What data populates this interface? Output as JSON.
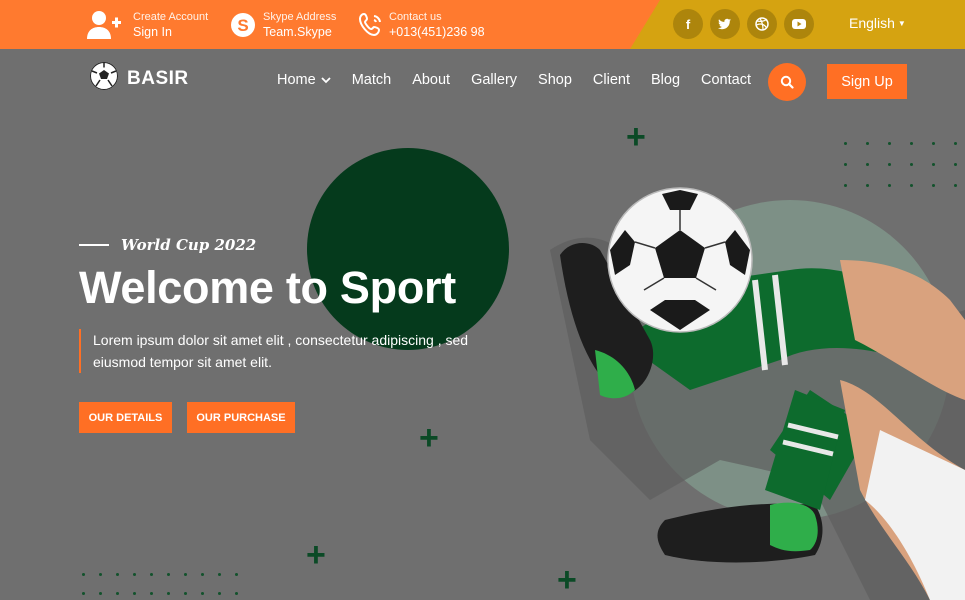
{
  "topbar": {
    "account": {
      "small": "Create Account",
      "big": "Sign In",
      "icon": "add-user-icon"
    },
    "skype": {
      "small": "Skype Address",
      "big": "Team.Skype",
      "icon": "skype-icon"
    },
    "contact": {
      "small": "Contact us",
      "big": "+013(451)236 98",
      "icon": "phone-icon"
    },
    "socials": [
      "facebook-icon",
      "twitter-icon",
      "dribbble-icon",
      "youtube-icon"
    ],
    "language": "English"
  },
  "brand": {
    "name": "BASIR"
  },
  "nav": {
    "items": [
      "Home",
      "Match",
      "About",
      "Gallery",
      "Shop",
      "Client",
      "Blog",
      "Contact"
    ],
    "signup": "Sign Up"
  },
  "hero": {
    "subtitle": "World Cup 2022",
    "title": "Welcome to Sport",
    "description": "Lorem ipsum dolor sit amet elit , consectetur adipiscing , sed eiusmod tempor sit amet elit.",
    "btn_details": "OUR DETAILS",
    "btn_purchase": "OUR PURCHASE"
  },
  "colors": {
    "orange": "#ff7a2f",
    "gold": "#d5a311",
    "dark_green": "#053a1c",
    "background": "#6f6f6f"
  }
}
